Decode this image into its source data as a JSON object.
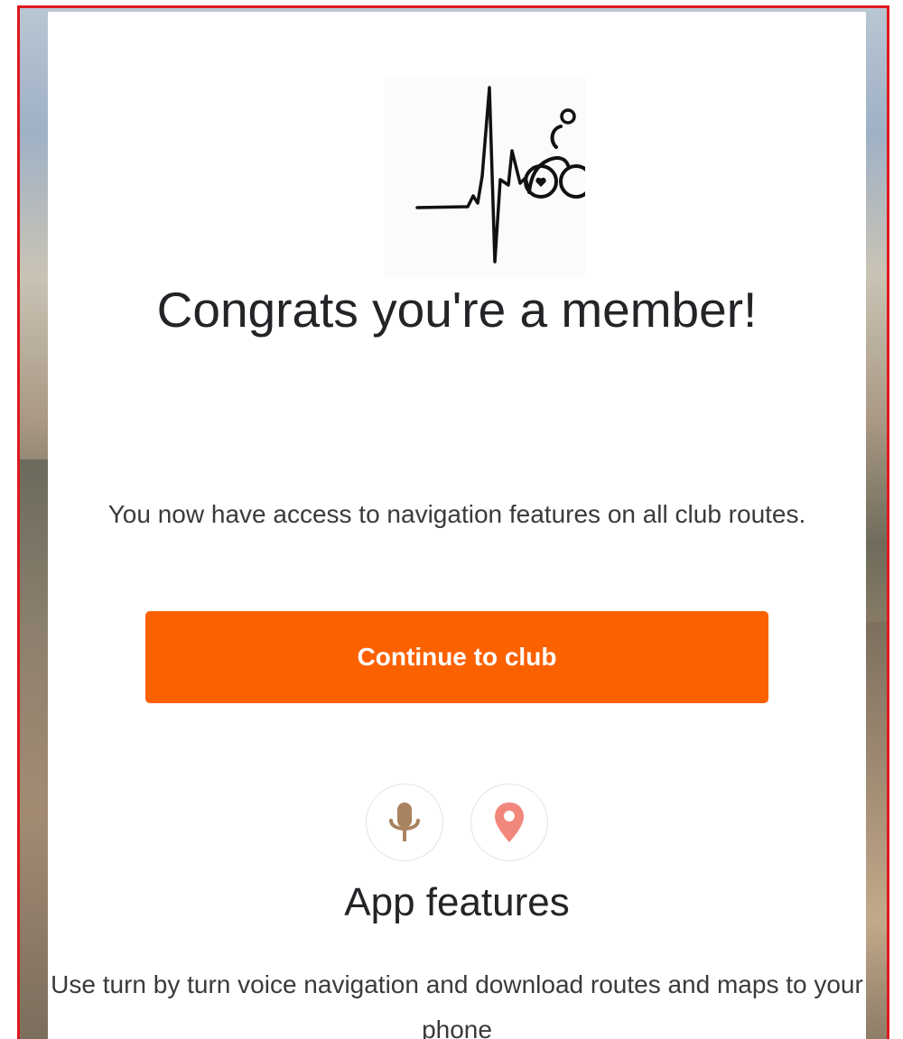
{
  "modal": {
    "logo_name": "heartbeat-cyclist-logo",
    "title": "Congrats you're a member!",
    "subtitle": "You now have access to navigation features on all club routes.",
    "continue_label": "Continue to club"
  },
  "features": {
    "icons": [
      "microphone-icon",
      "location-pin-icon"
    ],
    "title": "App features",
    "description": "Use turn by turn voice navigation and download routes and maps to your phone"
  },
  "colors": {
    "accent": "#fc6100",
    "frame_border": "#e0191f",
    "mic_icon": "#a9835f",
    "pin_icon": "#f2877c",
    "text": "#242428"
  }
}
